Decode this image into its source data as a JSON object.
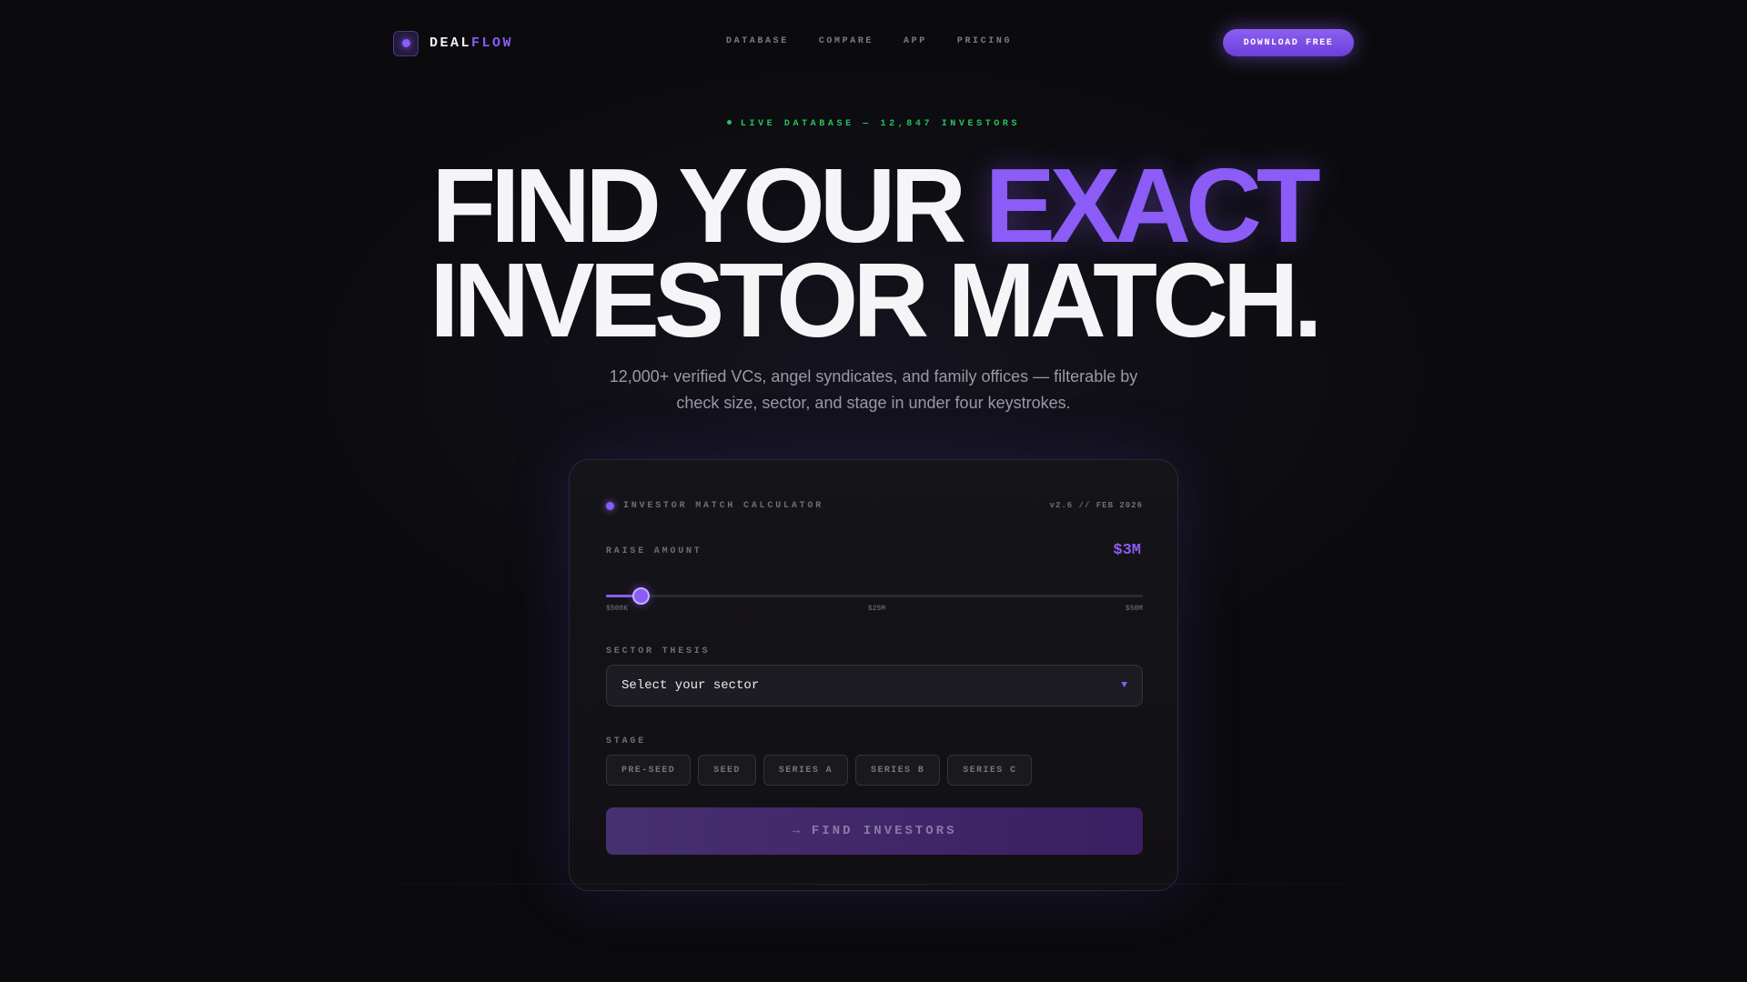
{
  "brand": {
    "name_part1": "DEAL",
    "name_part2": "FLOW"
  },
  "nav": {
    "links": [
      "DATABASE",
      "COMPARE",
      "APP",
      "PRICING"
    ],
    "cta": "DOWNLOAD FREE"
  },
  "hero": {
    "live_badge": "LIVE DATABASE — 12,847 INVESTORS",
    "headline_line1_a": "FIND YOUR ",
    "headline_line1_b": "EXACT",
    "headline_line2": "INVESTOR MATCH.",
    "subtitle": "12,000+ verified VCs, angel syndicates, and family offices — filterable by check size, sector, and stage in under four keystrokes."
  },
  "calculator": {
    "title": "INVESTOR MATCH CALCULATOR",
    "version": "v2.6 // FEB 2026",
    "raise": {
      "label": "RAISE AMOUNT",
      "value": "$3M",
      "slider_fraction": 0.064,
      "tick_min": "$500K",
      "tick_mid": "$25M",
      "tick_max": "$50M"
    },
    "sector": {
      "label": "SECTOR THESIS",
      "selected": "Select your sector"
    },
    "stage": {
      "label": "STAGE",
      "options": [
        "PRE-SEED",
        "SEED",
        "SERIES A",
        "SERIES B",
        "SERIES C"
      ]
    },
    "submit": {
      "arrow": "→",
      "label": "FIND INVESTORS"
    }
  },
  "colors": {
    "accent": "#8b5cf6",
    "live": "#22c55e",
    "background": "#0b0b0e"
  }
}
